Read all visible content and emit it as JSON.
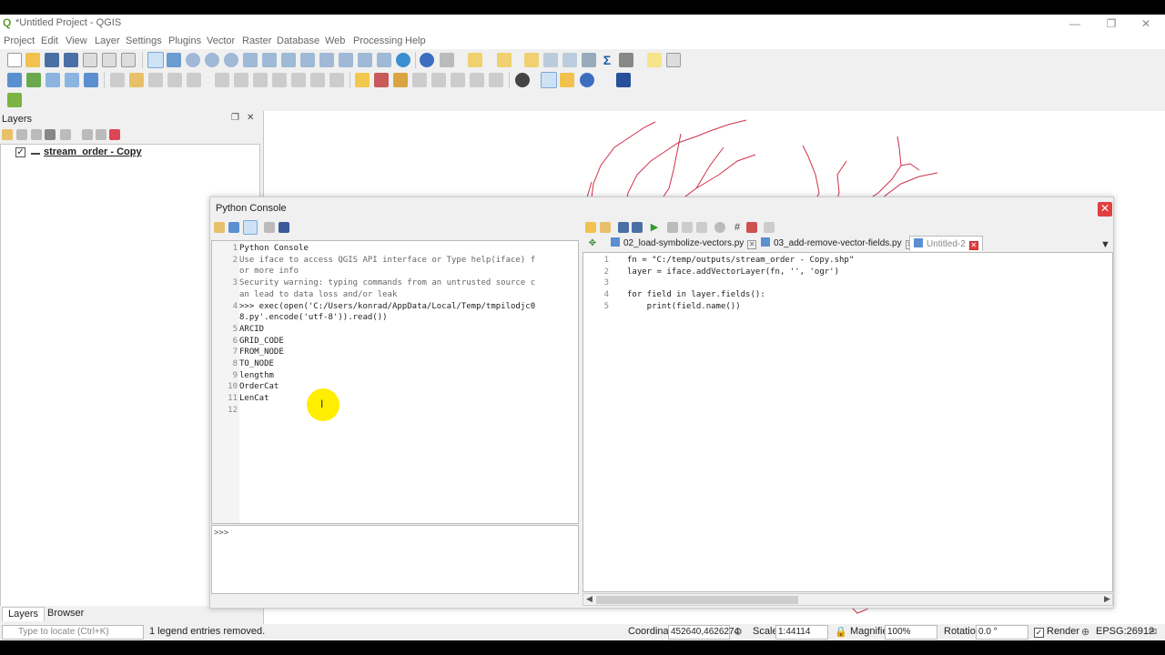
{
  "window": {
    "title": "*Untitled Project - QGIS",
    "minimize": "—",
    "maximize": "❐",
    "close": "✕"
  },
  "menubar": [
    "Project",
    "Edit",
    "View",
    "Layer",
    "Settings",
    "Plugins",
    "Vector",
    "Raster",
    "Database",
    "Web",
    "Processing",
    "Help"
  ],
  "layers_panel": {
    "title": "Layers",
    "layers": [
      {
        "name": "stream_order - Copy",
        "checked": true
      }
    ]
  },
  "bottom_tabs": [
    "Layers",
    "Browser"
  ],
  "status": {
    "locate_placeholder": "Type to locate (Ctrl+K)",
    "message": "1 legend entries removed.",
    "coordinate_label": "Coordinate",
    "coordinate_value": "452640,4626274",
    "scale_label": "Scale",
    "scale_value": "1:44114",
    "magnifier_label": "Magnifier",
    "magnifier_value": "100%",
    "rotation_label": "Rotation",
    "rotation_value": "0.0 °",
    "render_label": "Render",
    "crs": "EPSG:26912"
  },
  "console": {
    "title": "Python Console",
    "output_lines": [
      {
        "n": "1",
        "text": "Python Console"
      },
      {
        "n": "2",
        "text": "Use iface to access QGIS API interface or Type help(iface) f"
      },
      {
        "n": "",
        "text": "or more info"
      },
      {
        "n": "3",
        "text": "Security warning: typing commands from an untrusted source c"
      },
      {
        "n": "",
        "text": "an lead to data loss and/or leak"
      },
      {
        "n": "4",
        "text": ">>> exec(open('C:/Users/konrad/AppData/Local/Temp/tmpilodjc0"
      },
      {
        "n": "",
        "text": "8.py'.encode('utf-8')).read())"
      },
      {
        "n": "5",
        "text": "ARCID"
      },
      {
        "n": "6",
        "text": "GRID_CODE"
      },
      {
        "n": "7",
        "text": "FROM_NODE"
      },
      {
        "n": "8",
        "text": "TO_NODE"
      },
      {
        "n": "9",
        "text": "lengthm"
      },
      {
        "n": "10",
        "text": "OrderCat"
      },
      {
        "n": "11",
        "text": "LenCat"
      },
      {
        "n": "12",
        "text": ""
      }
    ],
    "prompt": ">>>",
    "editor_tabs": [
      "02_load-symbolize-vectors.py",
      "03_add-remove-vector-fields.py",
      "Untitled-2"
    ],
    "editor_lines": [
      {
        "n": "1",
        "text": "fn = \"C:/temp/outputs/stream_order - Copy.shp\""
      },
      {
        "n": "2",
        "text": "layer = iface.addVectorLayer(fn, '', 'ogr')"
      },
      {
        "n": "3",
        "text": ""
      },
      {
        "n": "4",
        "text": "for field in layer.fields():"
      },
      {
        "n": "5",
        "text": "    print(field.name())"
      }
    ]
  },
  "colors": {
    "accent_close": "#e04040",
    "stream": "#d0304a",
    "highlight": "#ffee00"
  }
}
